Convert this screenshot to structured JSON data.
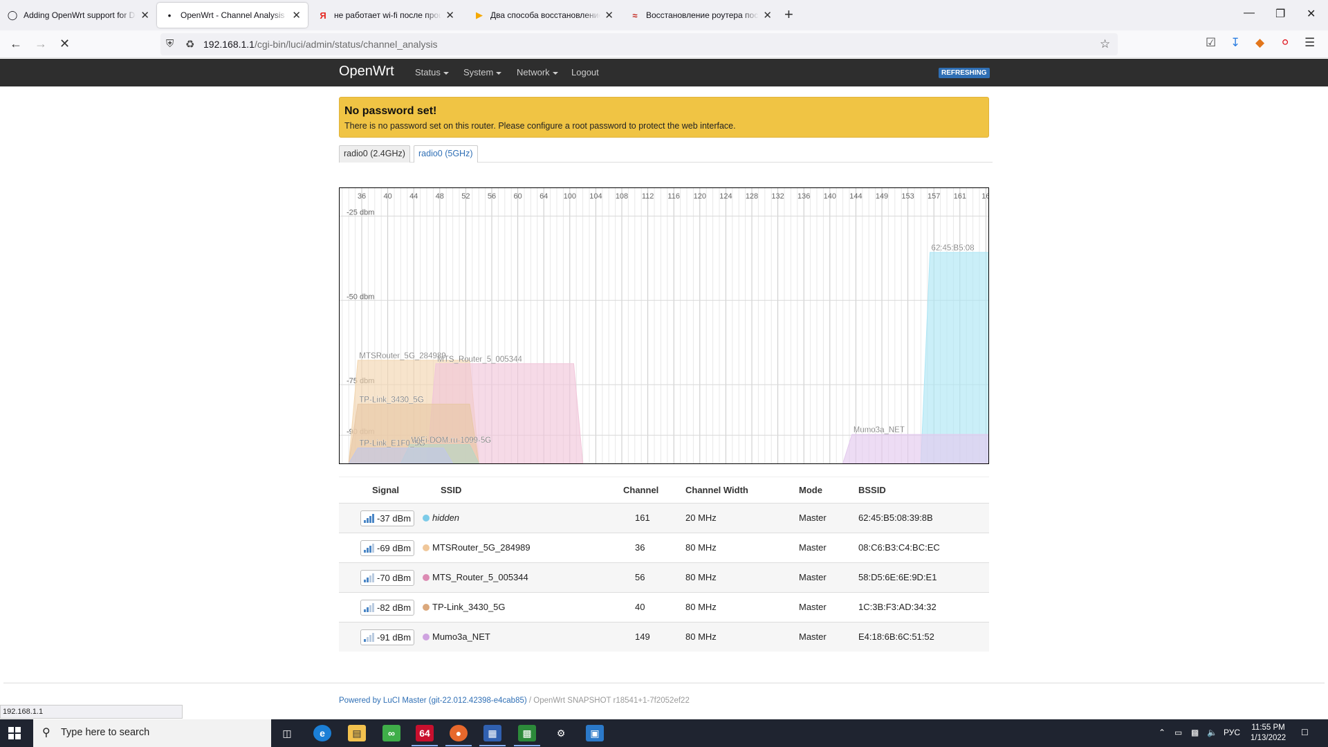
{
  "browser": {
    "tabs": [
      {
        "title": "Adding OpenWrt support for D-Link",
        "favicon": "github-icon"
      },
      {
        "title": "OpenWrt - Channel Analysis - LuCI",
        "favicon": "loading-dot-icon"
      },
      {
        "title": "не работает wi-fi после прошивки",
        "favicon": "yandex-icon"
      },
      {
        "title": "Два способа восстановление роутера",
        "favicon": "youtube-play-icon"
      },
      {
        "title": "Восстановление роутера после",
        "favicon": "wifi-icon"
      }
    ],
    "url_host": "192.168.1.1",
    "url_path": "/cgi-bin/luci/admin/status/channel_analysis",
    "status_url": "192.168.1.1"
  },
  "luci": {
    "brand": "OpenWrt",
    "menu": [
      "Status",
      "System",
      "Network",
      "Logout"
    ],
    "refresh_badge": "REFRESHING",
    "alert_title": "No password set!",
    "alert_text": "There is no password set on this router. Please configure a root password to protect the web interface.",
    "radio_tabs": [
      "radio0 (2.4GHz)",
      "radio0 (5GHz)"
    ]
  },
  "chart_data": {
    "type": "area",
    "channels": [
      "36",
      "40",
      "44",
      "48",
      "52",
      "56",
      "60",
      "64",
      "100",
      "104",
      "108",
      "112",
      "116",
      "120",
      "124",
      "128",
      "132",
      "136",
      "140",
      "144",
      "149",
      "153",
      "157",
      "161",
      "16"
    ],
    "y_ticks": [
      "-25 dbm",
      "-50 dbm",
      "-75 dbm",
      "-90 dbm"
    ],
    "networks": [
      {
        "label": "62:45:B5:08",
        "start": 22,
        "end": 24,
        "dbm": -37,
        "color": "#aee6f5"
      },
      {
        "label": "MTSRouter_5G_284989",
        "start": 0,
        "end": 4,
        "dbm": -69,
        "color": "#f2d6b0"
      },
      {
        "label": "MTS_Router_5_005344",
        "start": 3,
        "end": 8,
        "dbm": -70,
        "color": "#f1c6da"
      },
      {
        "label": "TP-Link_3430_5G",
        "start": 0,
        "end": 4,
        "dbm": -82,
        "color": "#e8c8a6"
      },
      {
        "label": "Mumo3a_NET",
        "start": 19,
        "end": 24,
        "dbm": -91,
        "color": "#e3c9ee"
      },
      {
        "label": "WiFi-DOM.ru-1099-5G",
        "start": 2,
        "end": 4,
        "dbm": -94,
        "color": "#b7d6c4"
      },
      {
        "label": "TP-Link_E1F0_5G",
        "start": 0,
        "end": 3,
        "dbm": -95,
        "color": "#c2c8e8"
      }
    ]
  },
  "table": {
    "headers": [
      "Signal",
      "SSID",
      "Channel",
      "Channel Width",
      "Mode",
      "BSSID"
    ],
    "rows": [
      {
        "signal": "-37 dBm",
        "ssid": "hidden",
        "channel": "161",
        "width": "20 MHz",
        "mode": "Master",
        "bssid": "62:45:B5:08:39:8B",
        "color": "#7ccbe8"
      },
      {
        "signal": "-69 dBm",
        "ssid": "MTSRouter_5G_284989",
        "channel": "36",
        "width": "80 MHz",
        "mode": "Master",
        "bssid": "08:C6:B3:C4:BC:EC",
        "color": "#f0c79a"
      },
      {
        "signal": "-70 dBm",
        "ssid": "MTS_Router_5_005344",
        "channel": "56",
        "width": "80 MHz",
        "mode": "Master",
        "bssid": "58:D5:6E:6E:9D:E1",
        "color": "#dc8bb3"
      },
      {
        "signal": "-82 dBm",
        "ssid": "TP-Link_3430_5G",
        "channel": "40",
        "width": "80 MHz",
        "mode": "Master",
        "bssid": "1C:3B:F3:AD:34:32",
        "color": "#dba87c"
      },
      {
        "signal": "-91 dBm",
        "ssid": "Mumo3a_NET",
        "channel": "149",
        "width": "80 MHz",
        "mode": "Master",
        "bssid": "E4:18:6B:6C:51:52",
        "color": "#cfa3e0"
      }
    ]
  },
  "footer": {
    "powered_link": "Powered by LuCI Master (git-22.012.42398-e4cab85)",
    "separator": " / ",
    "version": "OpenWrt SNAPSHOT r18541+1-7f2052ef22"
  },
  "taskbar": {
    "search_placeholder": "Type here to search",
    "lang": "РУС",
    "time": "11:55 PM",
    "date": "1/13/2022"
  }
}
